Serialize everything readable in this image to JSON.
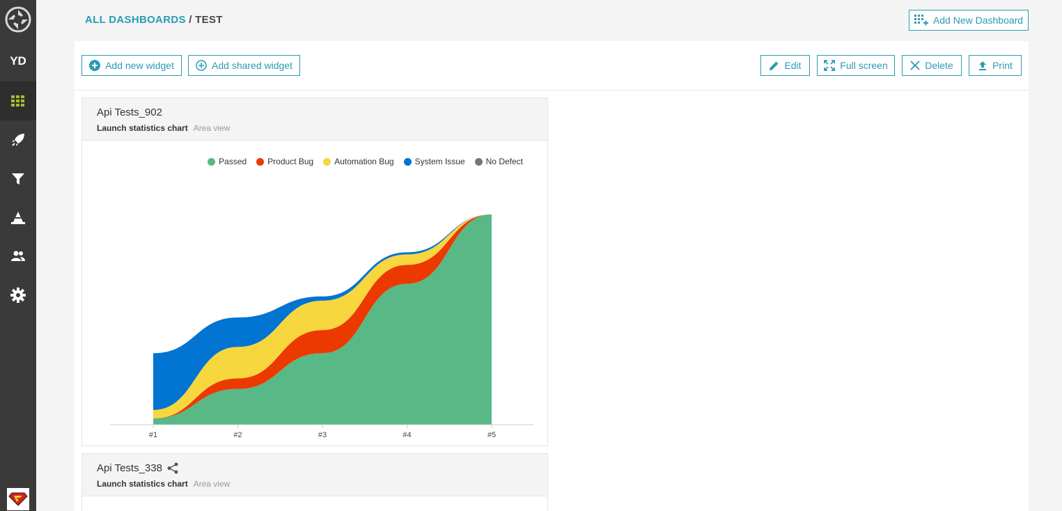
{
  "sidebar": {
    "user_initials": "YD",
    "items": [
      {
        "name": "dashboards",
        "icon": "grid-icon",
        "active": true
      },
      {
        "name": "launches",
        "icon": "rocket-icon"
      },
      {
        "name": "filters",
        "icon": "filter-icon"
      },
      {
        "name": "debug",
        "icon": "debug-icon"
      },
      {
        "name": "members",
        "icon": "members-icon"
      },
      {
        "name": "settings",
        "icon": "gear-icon"
      }
    ]
  },
  "header": {
    "breadcrumb_root": "ALL DASHBOARDS",
    "breadcrumb_sep": " / ",
    "breadcrumb_current": "TEST",
    "add_dashboard_label": "Add New Dashboard"
  },
  "toolbar": {
    "add_widget_label": "Add new widget",
    "add_shared_label": "Add shared widget",
    "edit_label": "Edit",
    "fullscreen_label": "Full screen",
    "delete_label": "Delete",
    "print_label": "Print"
  },
  "colors": {
    "accent": "#2a9bb5",
    "passed": "#58b986",
    "product_bug": "#ec3900",
    "automation_bug": "#f7d63e",
    "system_issue": "#0274d1",
    "no_defect": "#777777"
  },
  "widgets": [
    {
      "title": "Api Tests_902",
      "type": "Launch statistics chart",
      "view": "Area view",
      "shared": false,
      "legend": [
        "Passed",
        "Product Bug",
        "Automation Bug",
        "System Issue",
        "No Defect"
      ],
      "chart_data": {
        "type": "area",
        "categories": [
          "#1",
          "#2",
          "#3",
          "#4",
          "#5"
        ],
        "stacked": true,
        "grid": false,
        "legend_position": "top-right",
        "series": [
          {
            "name": "Passed",
            "values": [
              3,
              17,
              34,
              67,
              100
            ]
          },
          {
            "name": "Product Bug",
            "values": [
              0,
              5,
              11,
              9,
              0
            ]
          },
          {
            "name": "Automation Bug",
            "values": [
              4,
              15,
              14,
              5,
              0
            ]
          },
          {
            "name": "System Issue",
            "values": [
              27,
              14,
              2,
              1,
              0
            ]
          },
          {
            "name": "No Defect",
            "values": [
              0,
              0,
              0,
              0,
              0
            ]
          }
        ]
      }
    },
    {
      "title": "Api Tests_338",
      "type": "Launch statistics chart",
      "view": "Area view",
      "shared": true
    }
  ]
}
